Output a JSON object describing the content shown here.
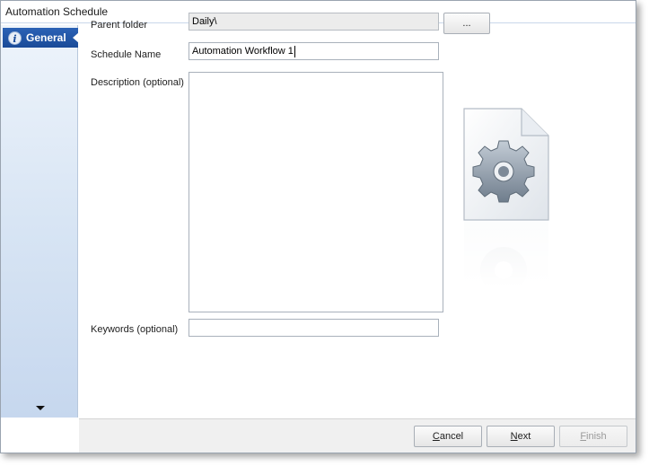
{
  "window": {
    "title": "Automation Schedule"
  },
  "sidebar": {
    "items": [
      {
        "label": "General",
        "icon": "info-icon",
        "active": true
      }
    ],
    "scroll_icon": "chevron-down-icon"
  },
  "form": {
    "parent_folder": {
      "label": "Parent folder",
      "value": "Daily\\",
      "browse_label": "..."
    },
    "schedule_name": {
      "label": "Schedule Name",
      "value": "Automation Workflow 1"
    },
    "description": {
      "label": "Description (optional)",
      "value": ""
    },
    "keywords": {
      "label": "Keywords (optional)",
      "value": ""
    }
  },
  "illustration": {
    "icon": "document-gear-icon"
  },
  "footer": {
    "cancel_prefix": "",
    "cancel_mnemonic": "C",
    "cancel_rest": "ancel",
    "next_prefix": "",
    "next_mnemonic": "N",
    "next_rest": "ext",
    "finish_prefix": "",
    "finish_mnemonic": "F",
    "finish_rest": "inish",
    "finish_disabled": true
  }
}
